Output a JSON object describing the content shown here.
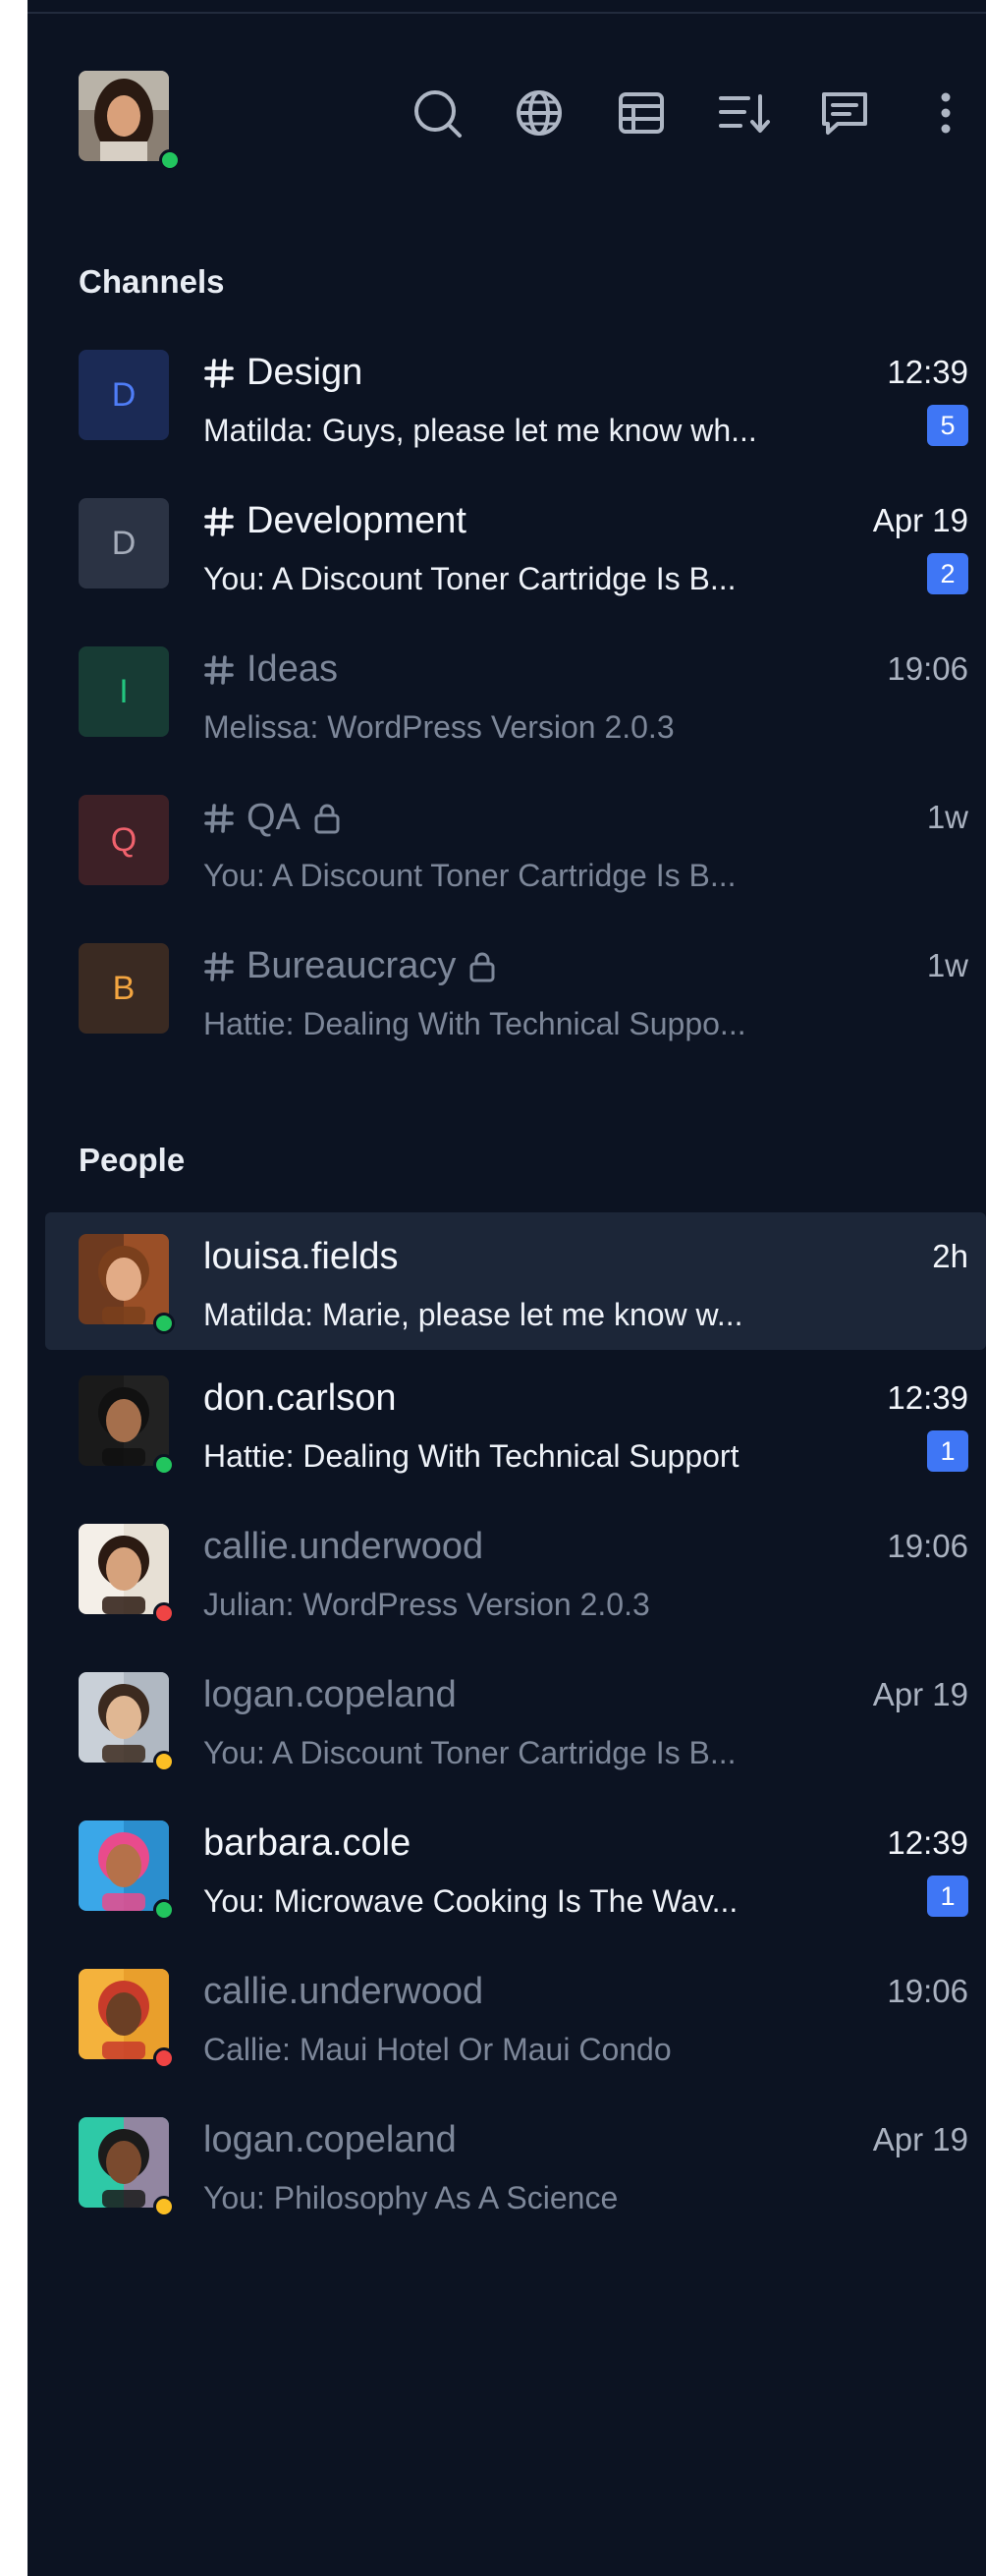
{
  "sections": {
    "channels_title": "Channels",
    "people_title": "People"
  },
  "toolbar": [
    {
      "name": "search-icon"
    },
    {
      "name": "globe-icon"
    },
    {
      "name": "table-icon"
    },
    {
      "name": "sort-icon"
    },
    {
      "name": "message-icon"
    },
    {
      "name": "more-vertical-icon"
    }
  ],
  "channels": [
    {
      "initial": "D",
      "name": "Design",
      "preview": "Matilda: Guys, please let me know wh...",
      "time": "12:39",
      "badge": "5",
      "locked": false,
      "unread": true,
      "tile_bg": "#1b2a55",
      "tile_fg": "#4f7df7"
    },
    {
      "initial": "D",
      "name": "Development",
      "preview": "You: A Discount Toner Cartridge Is B...",
      "time": "Apr 19",
      "badge": "2",
      "locked": false,
      "unread": true,
      "tile_bg": "#2b3344",
      "tile_fg": "#a5acba"
    },
    {
      "initial": "I",
      "name": "Ideas",
      "preview": "Melissa: WordPress Version 2.0.3",
      "time": "19:06",
      "badge": "",
      "locked": false,
      "unread": false,
      "tile_bg": "#173b34",
      "tile_fg": "#23c57f"
    },
    {
      "initial": "Q",
      "name": "QA",
      "preview": "You: A Discount Toner Cartridge Is B...",
      "time": "1w",
      "badge": "",
      "locked": true,
      "unread": false,
      "tile_bg": "#3d2026",
      "tile_fg": "#f0626d"
    },
    {
      "initial": "B",
      "name": "Bureaucracy",
      "preview": "Hattie: Dealing With Technical Suppo...",
      "time": "1w",
      "badge": "",
      "locked": true,
      "unread": false,
      "tile_bg": "#3a2a22",
      "tile_fg": "#f3a540"
    }
  ],
  "people": [
    {
      "name": "louisa.fields",
      "preview": "Matilda: Marie, please let me know w...",
      "time": "2h",
      "badge": "",
      "status": "online",
      "unread": true,
      "active": true
    },
    {
      "name": "don.carlson",
      "preview": "Hattie: Dealing With Technical Support",
      "time": "12:39",
      "badge": "1",
      "status": "online",
      "unread": true,
      "active": false
    },
    {
      "name": "callie.underwood",
      "preview": "Julian: WordPress Version 2.0.3",
      "time": "19:06",
      "badge": "",
      "status": "dnd",
      "unread": false,
      "active": false
    },
    {
      "name": "logan.copeland",
      "preview": "You: A Discount Toner Cartridge Is B...",
      "time": "Apr 19",
      "badge": "",
      "status": "away",
      "unread": false,
      "active": false
    },
    {
      "name": "barbara.cole",
      "preview": "You: Microwave Cooking Is The Wav...",
      "time": "12:39",
      "badge": "1",
      "status": "online",
      "unread": true,
      "active": false
    },
    {
      "name": "callie.underwood",
      "preview": "Callie: Maui Hotel Or Maui Condo",
      "time": "19:06",
      "badge": "",
      "status": "dnd",
      "unread": false,
      "active": false
    },
    {
      "name": "logan.copeland",
      "preview": "You: Philosophy As A Science",
      "time": "Apr 19",
      "badge": "",
      "status": "away",
      "unread": false,
      "active": false
    }
  ]
}
